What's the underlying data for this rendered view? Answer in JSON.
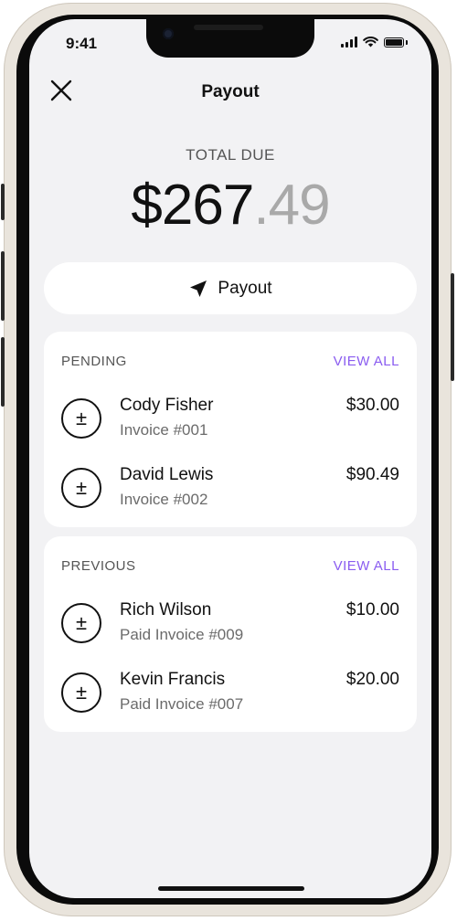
{
  "status": {
    "time": "9:41"
  },
  "header": {
    "title": "Payout"
  },
  "total": {
    "label": "TOTAL DUE",
    "dollars": "$267",
    "cents": ".49"
  },
  "payout_button": {
    "label": "Payout"
  },
  "pending": {
    "label": "PENDING",
    "view_all": "VIEW ALL",
    "items": [
      {
        "name": "Cody Fisher",
        "sub": "Invoice #001",
        "amount": "$30.00"
      },
      {
        "name": "David Lewis",
        "sub": "Invoice #002",
        "amount": "$90.49"
      }
    ]
  },
  "previous": {
    "label": "PREVIOUS",
    "view_all": "VIEW ALL",
    "items": [
      {
        "name": "Rich Wilson",
        "sub": "Paid Invoice #009",
        "amount": "$10.00"
      },
      {
        "name": "Kevin Francis",
        "sub": "Paid Invoice #007",
        "amount": "$20.00"
      }
    ]
  },
  "icons": {
    "close": "close-icon",
    "send": "send-icon",
    "transaction": "plus-minus-icon"
  },
  "colors": {
    "accent": "#8a5cf0",
    "background": "#f2f2f4",
    "card": "#ffffff"
  }
}
